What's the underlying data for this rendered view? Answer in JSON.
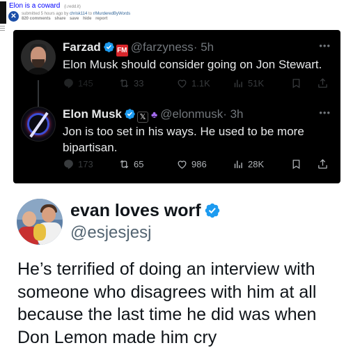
{
  "reddit": {
    "title": "Elon is a coward",
    "domain": "(i.redd.it)",
    "meta_prefix": "submitted 5 hours ago by ",
    "author": "chrisk114",
    "meta_mid": " to ",
    "subreddit": "r/MurderedByWords",
    "links": [
      "820 comments",
      "share",
      "save",
      "hide",
      "report"
    ],
    "avatar_glyph": "✕"
  },
  "dark_tweets": [
    {
      "name": "Farzad",
      "badge_text": "FM",
      "handle": "@farzyness",
      "time": "· 5h",
      "text": "Elon Musk should consider going on Jon Stewart.",
      "stats": {
        "replies": "145",
        "reposts": "33",
        "likes": "1.1K",
        "views": "51K"
      }
    },
    {
      "name": "Elon Musk",
      "badge_text": "𝕏",
      "handle": "@elonmusk",
      "time": "· 3h",
      "text": "Jon is too set in his ways. He used to be more bipartisan.",
      "stats": {
        "replies": "173",
        "reposts": "65",
        "likes": "986",
        "views": "28K"
      }
    }
  ],
  "main_tweet": {
    "name": "evan loves worf",
    "handle": "@esjesjesj",
    "text": "He’s terrified of doing an interview with someone who disagrees with him at all because the last time he did was when Don Lemon made him cry"
  },
  "icons": {
    "more": "more-dots-icon",
    "reply": "reply-icon",
    "repost": "repost-icon",
    "like": "like-icon",
    "views": "views-icon",
    "bookmark": "bookmark-icon",
    "share": "share-icon",
    "verified": "verified-badge-icon"
  },
  "colors": {
    "verified_blue": "#1d9bf0",
    "dark_bg": "#000000",
    "dark_text": "#e7e9ea",
    "muted": "#71767b",
    "link_blue": "#0000ff"
  }
}
